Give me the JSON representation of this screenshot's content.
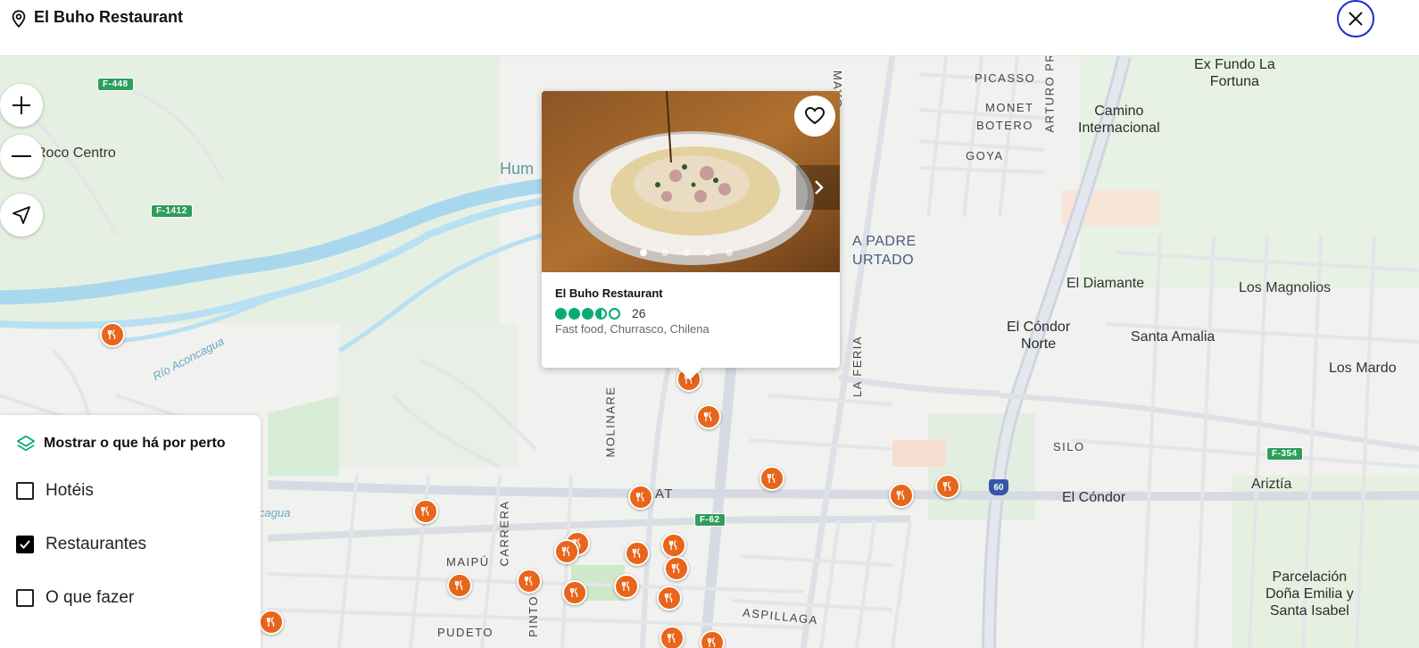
{
  "header": {
    "title": "El Buho Restaurant",
    "pin_icon": "location-pin-icon",
    "close_icon": "close-icon"
  },
  "map": {
    "controls": {
      "zoom_in": "plus-icon",
      "zoom_out": "minus-icon",
      "locate": "navigation-arrow-icon"
    },
    "labels": {
      "ex_fundo": "Ex Fundo La\nFortuna",
      "camino": "Camino\nInternacional",
      "picasso": "PICASSO",
      "monet": "MONET",
      "botero": "BOTERO",
      "goya": "GOYA",
      "arturo": "ARTURO PRA",
      "mayo": "MAYO",
      "roco": "Roco Centro",
      "hum": "Hum",
      "padre1": "A PADRE",
      "padre2": "URTADO",
      "diamante": "El Diamante",
      "magnolios": "Los Magnolios",
      "condor_norte": "El Cóndor\nNorte",
      "santa_amalia": "Santa Amalia",
      "mardo": "Los Mardo",
      "feria": "LA FERIA",
      "molinare": "MOLINARE",
      "aconcagua": "Río Aconcagua",
      "cagua": "cagua",
      "silo": "SILO",
      "el_condor": "El Cóndor",
      "ariztia": "Ariztía",
      "at": "AT",
      "carrera": "CARRERA",
      "maipu": "MAIPÚ",
      "pinto": "PINTO",
      "pudeto": "PUDETO",
      "aspillaga": "ASPILLAGA",
      "parcelacion": "Parcelación\nDoña Emilia y\nSanta Isabel"
    },
    "shields": {
      "f448": "F-448",
      "f1412": "F-1412",
      "f62": "F-62",
      "f354": "F-354",
      "r60": "60"
    }
  },
  "card": {
    "name": "El Buho Restaurant",
    "rating": 3.5,
    "review_count": "26",
    "cuisine": "Fast food, Churrasco, Chilena",
    "photo_count": 5,
    "colors": {
      "rating": "#00aa6c",
      "poi": "#e8651c"
    }
  },
  "nearby_panel": {
    "title": "Mostrar o que há por perto",
    "options": [
      {
        "label": "Hotéis",
        "checked": false
      },
      {
        "label": "Restaurantes",
        "checked": true
      },
      {
        "label": "O que fazer",
        "checked": false
      }
    ]
  }
}
